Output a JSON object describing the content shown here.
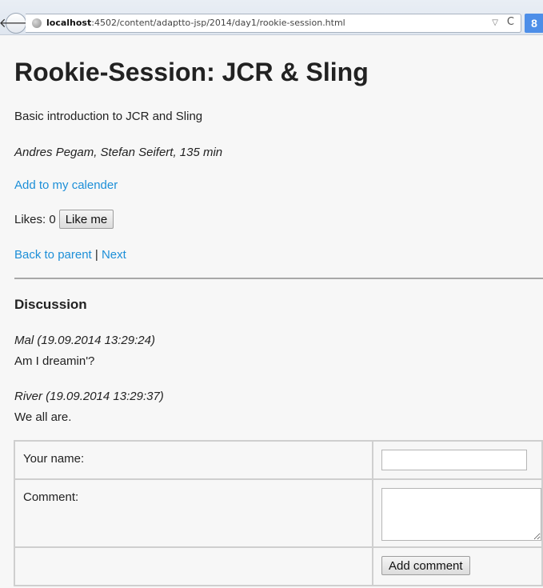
{
  "browser": {
    "url_host": "localhost",
    "url_path": ":4502/content/adaptto-jsp/2014/day1/rookie-session.html",
    "back_glyph": "🡐",
    "dropmarker_glyph": "▽",
    "reload_glyph": "C",
    "search_engine_glyph": "8"
  },
  "page": {
    "title": "Rookie-Session: JCR & Sling",
    "description": "Basic introduction to JCR and Sling",
    "authors_duration": "Andres Pegam, Stefan Seifert, 135 min",
    "calendar_link": "Add to my calender",
    "likes_label": "Likes: 0",
    "like_button": "Like me",
    "back_link": "Back to parent",
    "nav_separator": " | ",
    "next_link": "Next"
  },
  "discussion": {
    "heading": "Discussion",
    "comments": [
      {
        "meta": "Mal (19.09.2014 13:29:24)",
        "text": "Am I dreamin'?"
      },
      {
        "meta": "River (19.09.2014 13:29:37)",
        "text": "We all are."
      }
    ],
    "form": {
      "name_label": "Your name:",
      "comment_label": "Comment:",
      "submit_label": "Add comment",
      "name_value": "",
      "comment_value": ""
    }
  },
  "colors": {
    "link": "#1d8fd8",
    "background": "#f7f7f7",
    "text": "#222222"
  }
}
